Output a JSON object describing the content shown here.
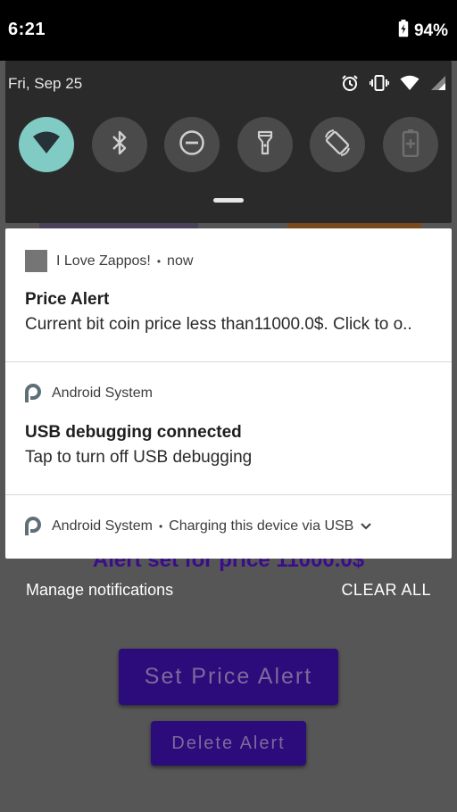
{
  "status_bar": {
    "time": "6:21",
    "battery_pct": "94%"
  },
  "quick_settings": {
    "date": "Fri, Sep 25",
    "tiles": [
      {
        "name": "wifi",
        "active": true
      },
      {
        "name": "bluetooth",
        "active": false
      },
      {
        "name": "do-not-disturb",
        "active": false
      },
      {
        "name": "flashlight",
        "active": false
      },
      {
        "name": "auto-rotate",
        "active": false
      },
      {
        "name": "battery-saver",
        "active": false
      }
    ]
  },
  "notifications": [
    {
      "app": "I Love Zappos!",
      "time": "now",
      "title": "Price Alert",
      "text": "Current bit coin price less than11000.0$. Click to o.."
    },
    {
      "app": "Android System",
      "title": "USB debugging connected",
      "text": "Tap to turn off USB debugging"
    },
    {
      "app": "Android System",
      "summary": "Charging this device via USB"
    }
  ],
  "footer": {
    "manage": "Manage notifications",
    "clear_all": "CLEAR ALL"
  },
  "background_app": {
    "alert_text": "Alert set for price 11000.0$",
    "set_alert_label": "Set Price Alert",
    "delete_alert_label": "Delete Alert"
  },
  "colors": {
    "accent_active_tile": "#80cbc4",
    "brand_purple": "#2c0b7a"
  }
}
